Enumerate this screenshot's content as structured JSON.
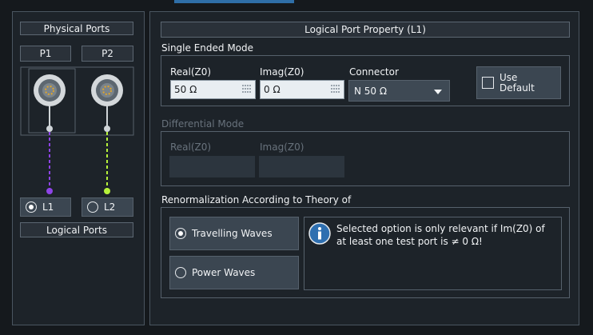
{
  "physical_ports": {
    "title": "Physical Ports",
    "ports": [
      "P1",
      "P2"
    ]
  },
  "logical_ports": {
    "title": "Logical Ports",
    "items": [
      {
        "label": "L1",
        "selected": true
      },
      {
        "label": "L2",
        "selected": false
      }
    ],
    "link_colors": [
      "#8e44e6",
      "#b6f23a"
    ]
  },
  "property": {
    "title": "Logical Port Property (L1)",
    "single_ended": {
      "label": "Single Ended Mode",
      "real_label": "Real(Z0)",
      "real_value": "50 Ω",
      "imag_label": "Imag(Z0)",
      "imag_value": "0 Ω",
      "connector_label": "Connector",
      "connector_value": "N 50 Ω",
      "use_default_line1": "Use",
      "use_default_line2": "Default",
      "use_default_checked": false
    },
    "differential": {
      "label": "Differential Mode",
      "real_label": "Real(Z0)",
      "imag_label": "Imag(Z0)"
    },
    "renorm": {
      "label": "Renormalization According to Theory of",
      "options": [
        {
          "label": "Travelling Waves",
          "selected": true
        },
        {
          "label": "Power Waves",
          "selected": false
        }
      ],
      "info_line1": "Selected option is only relevant if Im(Z0) of",
      "info_line2": "at least one test port is ≠ 0 Ω!"
    }
  }
}
